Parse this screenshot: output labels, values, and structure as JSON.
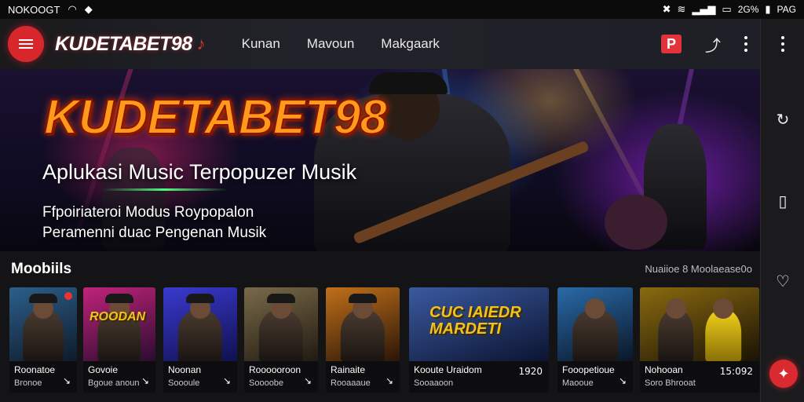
{
  "status_bar": {
    "carrier": "NOKOOGT",
    "right_text": "2G%",
    "network": "PAG"
  },
  "app_bar": {
    "brand": "KUDETABET98",
    "nav": [
      "Kunan",
      "Mavoun",
      "Makgaark"
    ],
    "logo_letter": "P"
  },
  "hero": {
    "title": "KUDETABET98",
    "subtitle": "Aplukasi Music Terpopuzer Musik",
    "line1": "Ffpoiriateroi Modus Roypopalon",
    "line2": "Peramenni duac Pengenan Musik"
  },
  "section": {
    "title": "Moobiils",
    "meta": "Nuaiioe 8 Moolaease0o"
  },
  "cards": [
    {
      "title": "Roonatoe",
      "sub": "Bronoe",
      "num": "",
      "bg": [
        "#2c5f8a",
        "#0e1a2a"
      ]
    },
    {
      "title": "Govoie",
      "sub": "Bgoue anoun",
      "num": "",
      "bg": [
        "#c2237a",
        "#2a0c30"
      ],
      "poster": "ROODAN"
    },
    {
      "title": "Noonan",
      "sub": "Soooule",
      "num": "",
      "bg": [
        "#3a3ad0",
        "#101050"
      ]
    },
    {
      "title": "Roooooroon",
      "sub": "Soooobe",
      "num": "",
      "bg": [
        "#7a6a4a",
        "#201a10"
      ]
    },
    {
      "title": "Rainaite",
      "sub": "Rooaaaue",
      "num": "",
      "bg": [
        "#c0701a",
        "#2a1508"
      ]
    },
    {
      "title": "Kooute Uraidom",
      "sub": "Sooaaoon",
      "num": "1920",
      "bg": [
        "#3a5aa0",
        "#0c1330"
      ],
      "poster": "CUC IAIEDR\nMARDETI"
    },
    {
      "title": "Fooopetioue",
      "sub": "Maooue",
      "num": "",
      "bg": [
        "#2a6aa8",
        "#0a1628"
      ]
    },
    {
      "title": "Nohooan",
      "sub": "Soro Bhrooat",
      "num": "15:092",
      "bg": [
        "#8a6a10",
        "#1a1305"
      ]
    }
  ]
}
